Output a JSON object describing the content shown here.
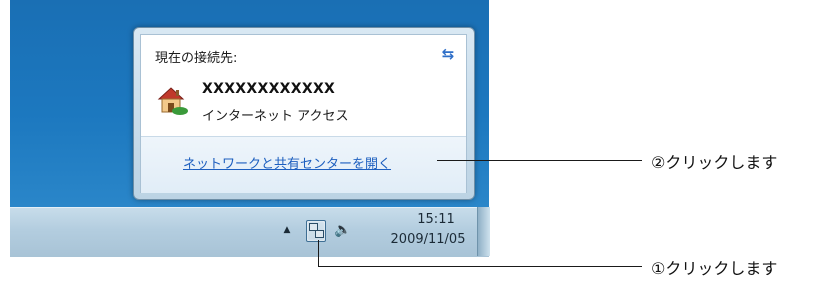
{
  "popup": {
    "title": "現在の接続先:",
    "network_name": "XXXXXXXXXXXX",
    "network_access": "インターネット アクセス",
    "link": "ネットワークと共有センターを開く",
    "icons": {
      "refresh": "refresh-icon",
      "network": "house-icon"
    }
  },
  "taskbar": {
    "time": "15:11",
    "date": "2009/11/05",
    "icons": [
      "tray-arrow-icon",
      "network-icon",
      "speaker-icon"
    ]
  },
  "callouts": [
    "②クリックします",
    "①クリックします"
  ],
  "colors": {
    "desktop": "#1c78bf",
    "link": "#1d5fbf",
    "taskbar": "#b3cddf"
  }
}
